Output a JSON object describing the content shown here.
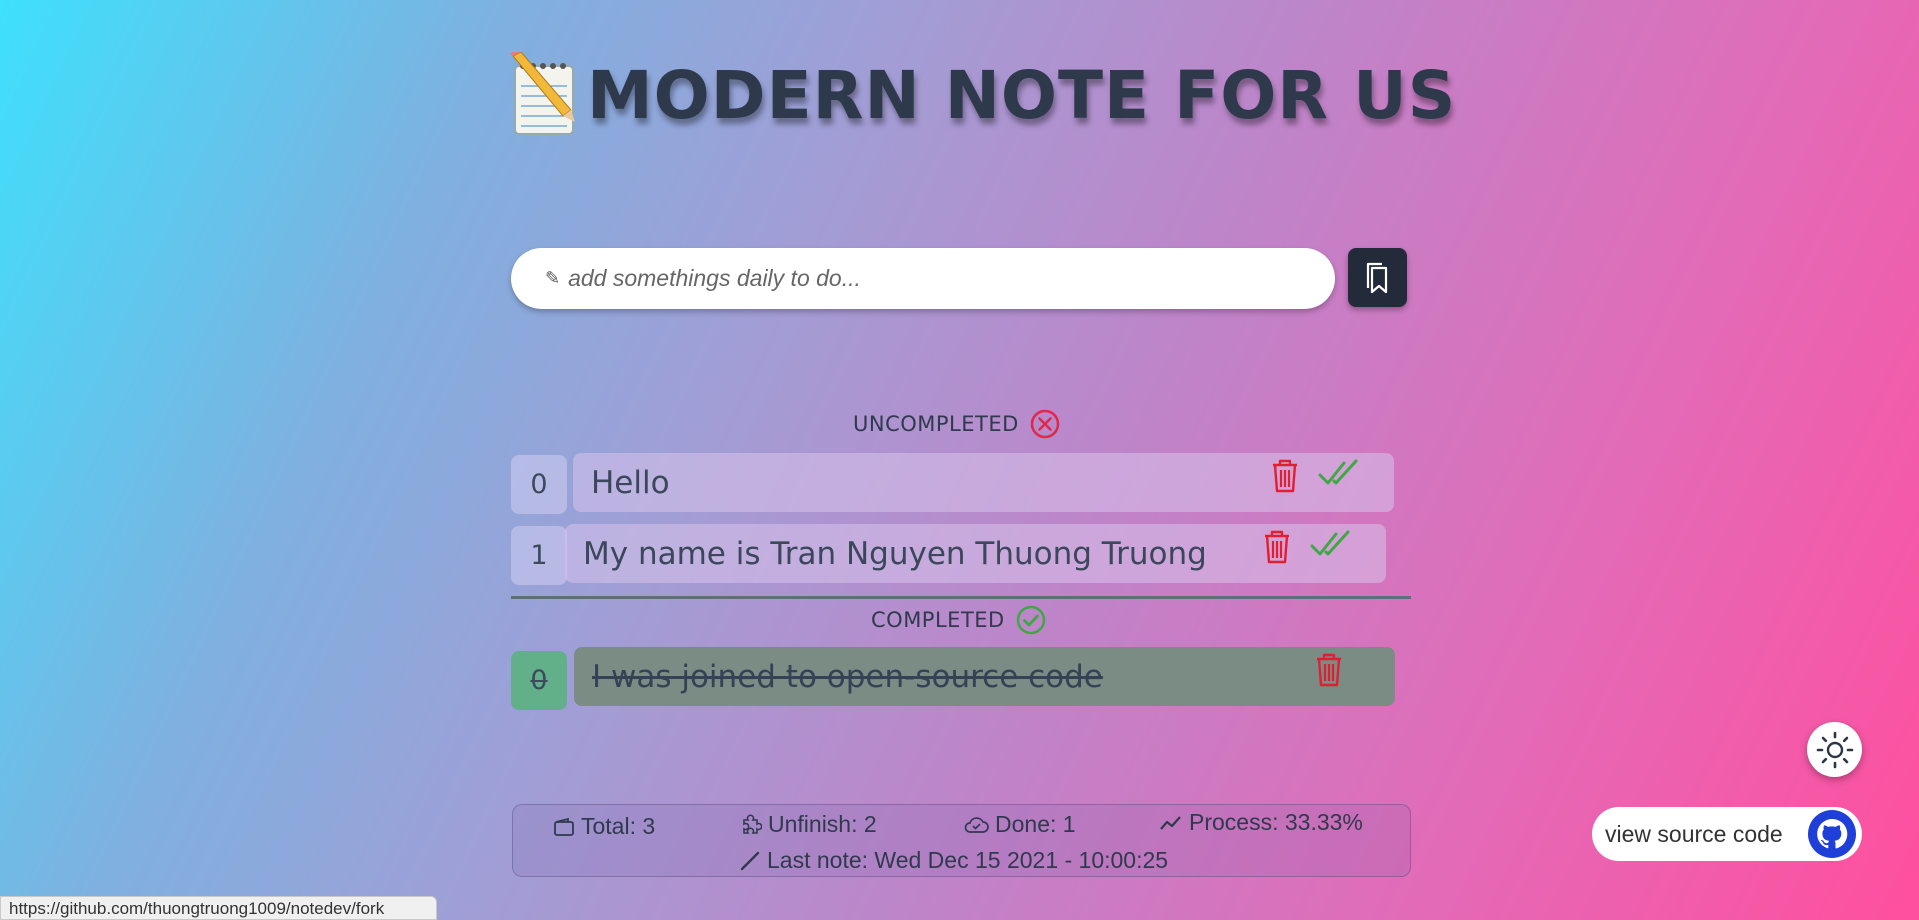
{
  "header": {
    "title": "MODERN NOTE FOR US",
    "icon": "notepad-pencil-icon"
  },
  "input": {
    "placeholder": "add somethings daily to do...",
    "value": "",
    "submit_icon": "bookmark-icon"
  },
  "uncompleted": {
    "label": "UNCOMPLETED",
    "icon": "x-circle-icon",
    "items": [
      {
        "index": "0",
        "text": "Hello"
      },
      {
        "index": "1",
        "text": "My name is Tran Nguyen Thuong Truong"
      }
    ]
  },
  "completed": {
    "label": "COMPLETED",
    "icon": "check-circle-icon",
    "items": [
      {
        "index": "0",
        "text": "I was joined to open-source code"
      }
    ]
  },
  "stats": {
    "total": "Total: 3",
    "unfinish": "Unfinish: 2",
    "done": "Done: 1",
    "process": "Process: 33.33%",
    "last_note": "Last note: Wed Dec 15 2021 - 10:00:25"
  },
  "source": {
    "label": "view source code",
    "icon": "github-icon"
  },
  "status_bar": {
    "url": "https://github.com/thuongtruong1009/notedev/fork"
  },
  "colors": {
    "delete": "#e02030",
    "check": "#3fa844",
    "dark_button": "#232b3a",
    "completed_bg": "#62b08a"
  }
}
